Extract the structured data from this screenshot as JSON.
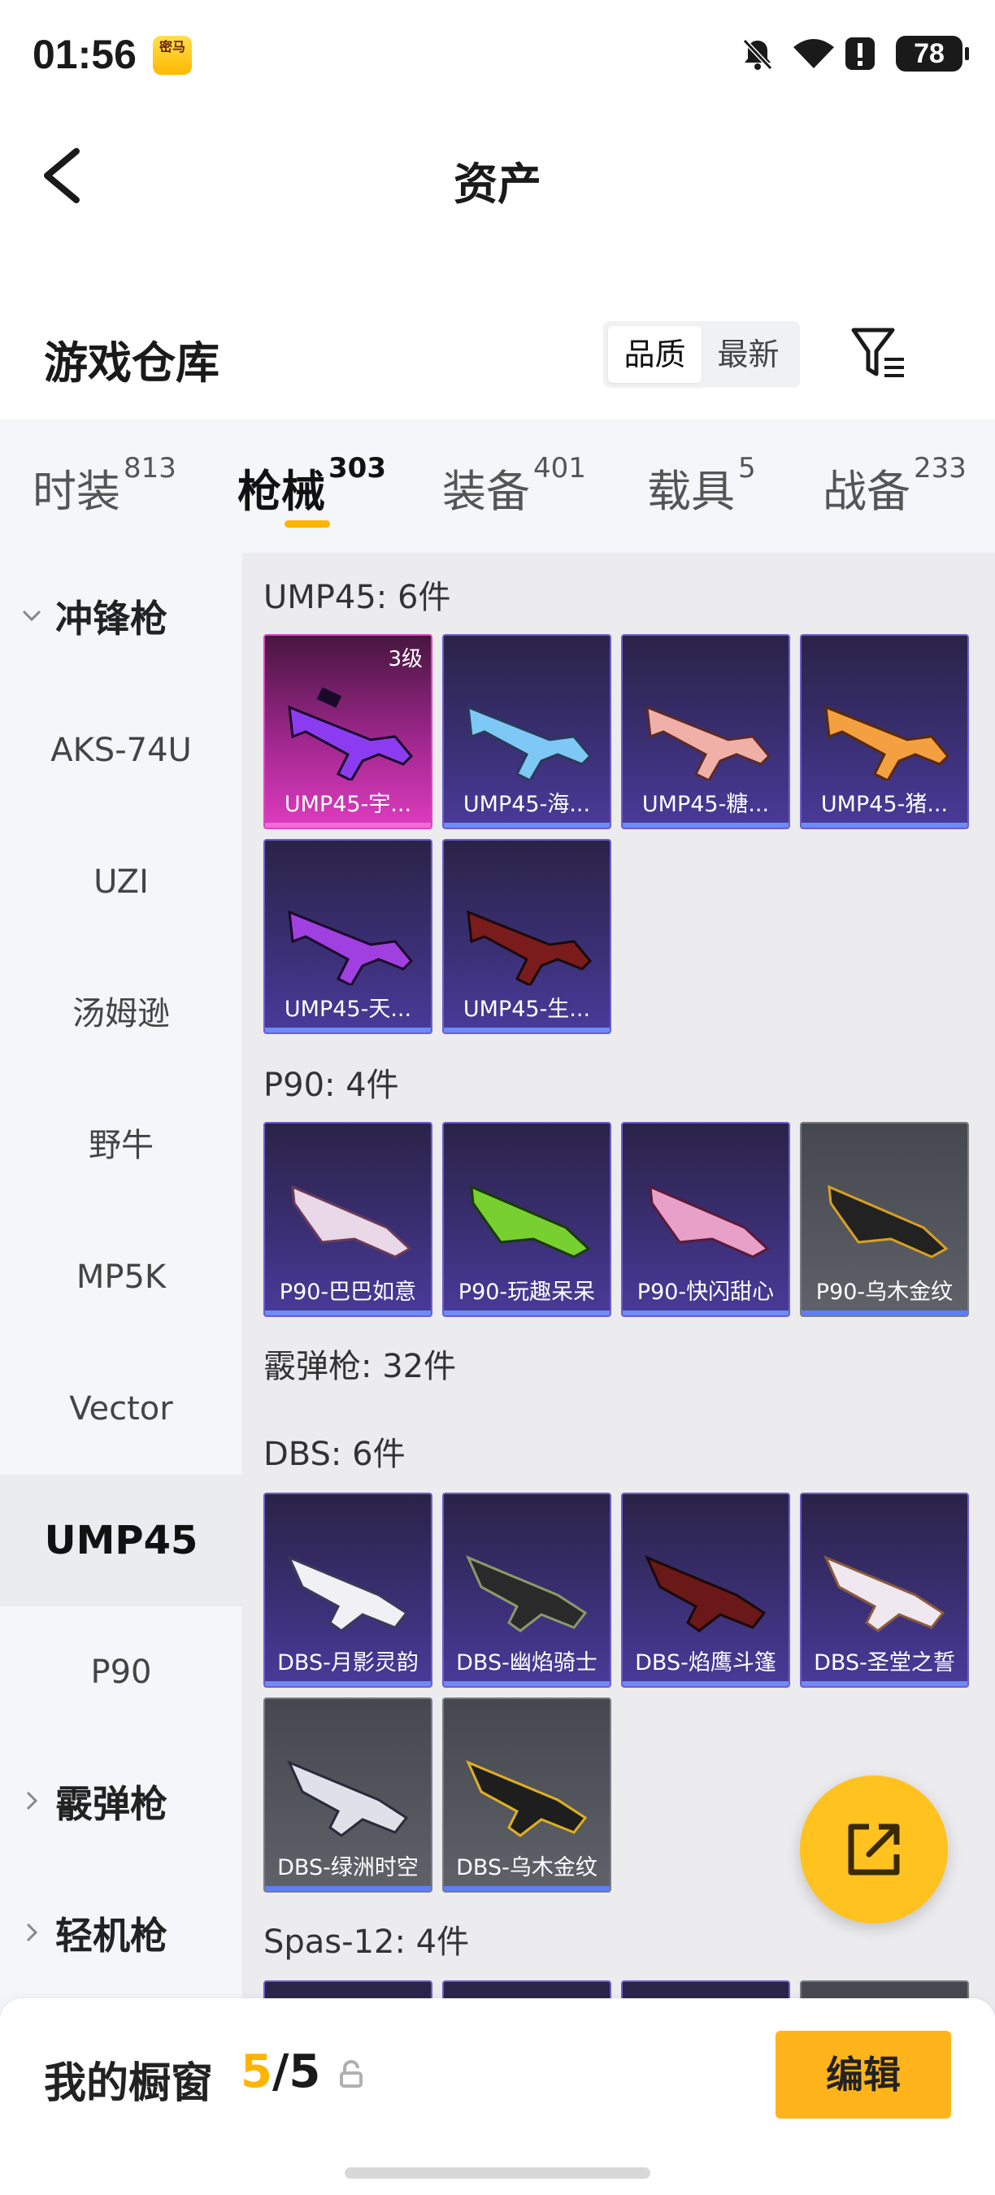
{
  "status_bar": {
    "time": "01:56",
    "app_badge": "密马",
    "battery": "78",
    "icons": [
      "bell-off-icon",
      "wifi-icon",
      "alert-icon",
      "battery-icon"
    ]
  },
  "header": {
    "title": "资产"
  },
  "warehouse": {
    "title": "游戏仓库",
    "sort_options": [
      "品质",
      "最新"
    ],
    "sort_selected": "品质"
  },
  "category_tabs": [
    {
      "label": "时装",
      "count": "813"
    },
    {
      "label": "枪械",
      "count": "303",
      "active": true
    },
    {
      "label": "装备",
      "count": "401"
    },
    {
      "label": "载具",
      "count": "5"
    },
    {
      "label": "战备",
      "count": "233"
    }
  ],
  "side_nav": [
    {
      "label": "冲锋枪",
      "type": "group",
      "expanded": true
    },
    {
      "label": "AKS-74U"
    },
    {
      "label": "UZI"
    },
    {
      "label": "汤姆逊"
    },
    {
      "label": "野牛"
    },
    {
      "label": "MP5K"
    },
    {
      "label": "Vector"
    },
    {
      "label": "UMP45",
      "active": true
    },
    {
      "label": "P90"
    },
    {
      "label": "霰弹枪",
      "type": "group",
      "expanded": false
    },
    {
      "label": "轻机枪",
      "type": "group",
      "expanded": false
    }
  ],
  "sections": [
    {
      "title": "UMP45: 6件",
      "items": [
        {
          "label": "UMP45-宇...",
          "badge": "3级",
          "rarity": "pink"
        },
        {
          "label": "UMP45-海...",
          "rarity": "purple"
        },
        {
          "label": "UMP45-糖...",
          "rarity": "purple"
        },
        {
          "label": "UMP45-猪...",
          "rarity": "purple"
        },
        {
          "label": "UMP45-天...",
          "rarity": "purple"
        },
        {
          "label": "UMP45-生...",
          "rarity": "purple"
        }
      ]
    },
    {
      "title": "P90: 4件",
      "items": [
        {
          "label": "P90-巴巴如意",
          "rarity": "purple"
        },
        {
          "label": "P90-玩趣呆呆",
          "rarity": "purple"
        },
        {
          "label": "P90-快闪甜心",
          "rarity": "purple"
        },
        {
          "label": "P90-乌木金纹",
          "rarity": "gray"
        }
      ]
    },
    {
      "title": "霰弹枪: 32件",
      "items": []
    },
    {
      "title": "DBS: 6件",
      "items": [
        {
          "label": "DBS-月影灵韵",
          "rarity": "purple"
        },
        {
          "label": "DBS-幽焰骑士",
          "rarity": "purple"
        },
        {
          "label": "DBS-焰鹰斗篷",
          "rarity": "purple"
        },
        {
          "label": "DBS-圣堂之誓",
          "rarity": "purple"
        },
        {
          "label": "DBS-绿洲时空",
          "rarity": "gray"
        },
        {
          "label": "DBS-乌木金纹",
          "rarity": "gray"
        }
      ]
    },
    {
      "title": "Spas-12: 4件",
      "items": []
    }
  ],
  "gun_colors": [
    "#8c3cf0",
    "#7ec8f5",
    "#f0b0a8",
    "#f5a040",
    "#a040e0",
    "#7a1c1c",
    "#e8d8e8",
    "#78d030",
    "#e8a0c8",
    "#222222",
    "#f0f0f5",
    "#2a2a2a",
    "#6a1818",
    "#f0e8f0",
    "#e0e0e8",
    "#1e1e1e"
  ],
  "showcase": {
    "title": "我的橱窗",
    "current": "5",
    "separator": "/",
    "total": "5",
    "edit_label": "编辑"
  },
  "colors": {
    "accent": "#ffb400",
    "rarity_purple": "#6f5cd0",
    "rarity_pink": "#e043c4",
    "rarity_gray": "#7a7c84"
  }
}
